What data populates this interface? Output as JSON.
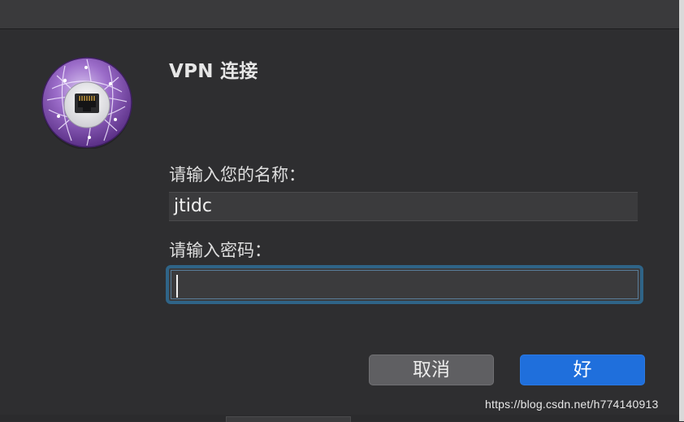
{
  "dialog": {
    "title": "VPN 连接",
    "icon": "network-vpn-icon",
    "name_label": "请输入您的名称：",
    "name_value": "jtidc",
    "password_label": "请输入密码：",
    "password_value": "",
    "cancel_label": "取消",
    "ok_label": "好"
  },
  "watermark": "https://blog.csdn.net/h774140913",
  "colors": {
    "background": "#2e2e30",
    "accent": "#1f6fdc",
    "focus_ring": "#2f6487",
    "icon_purple": "#7e4fb0"
  }
}
